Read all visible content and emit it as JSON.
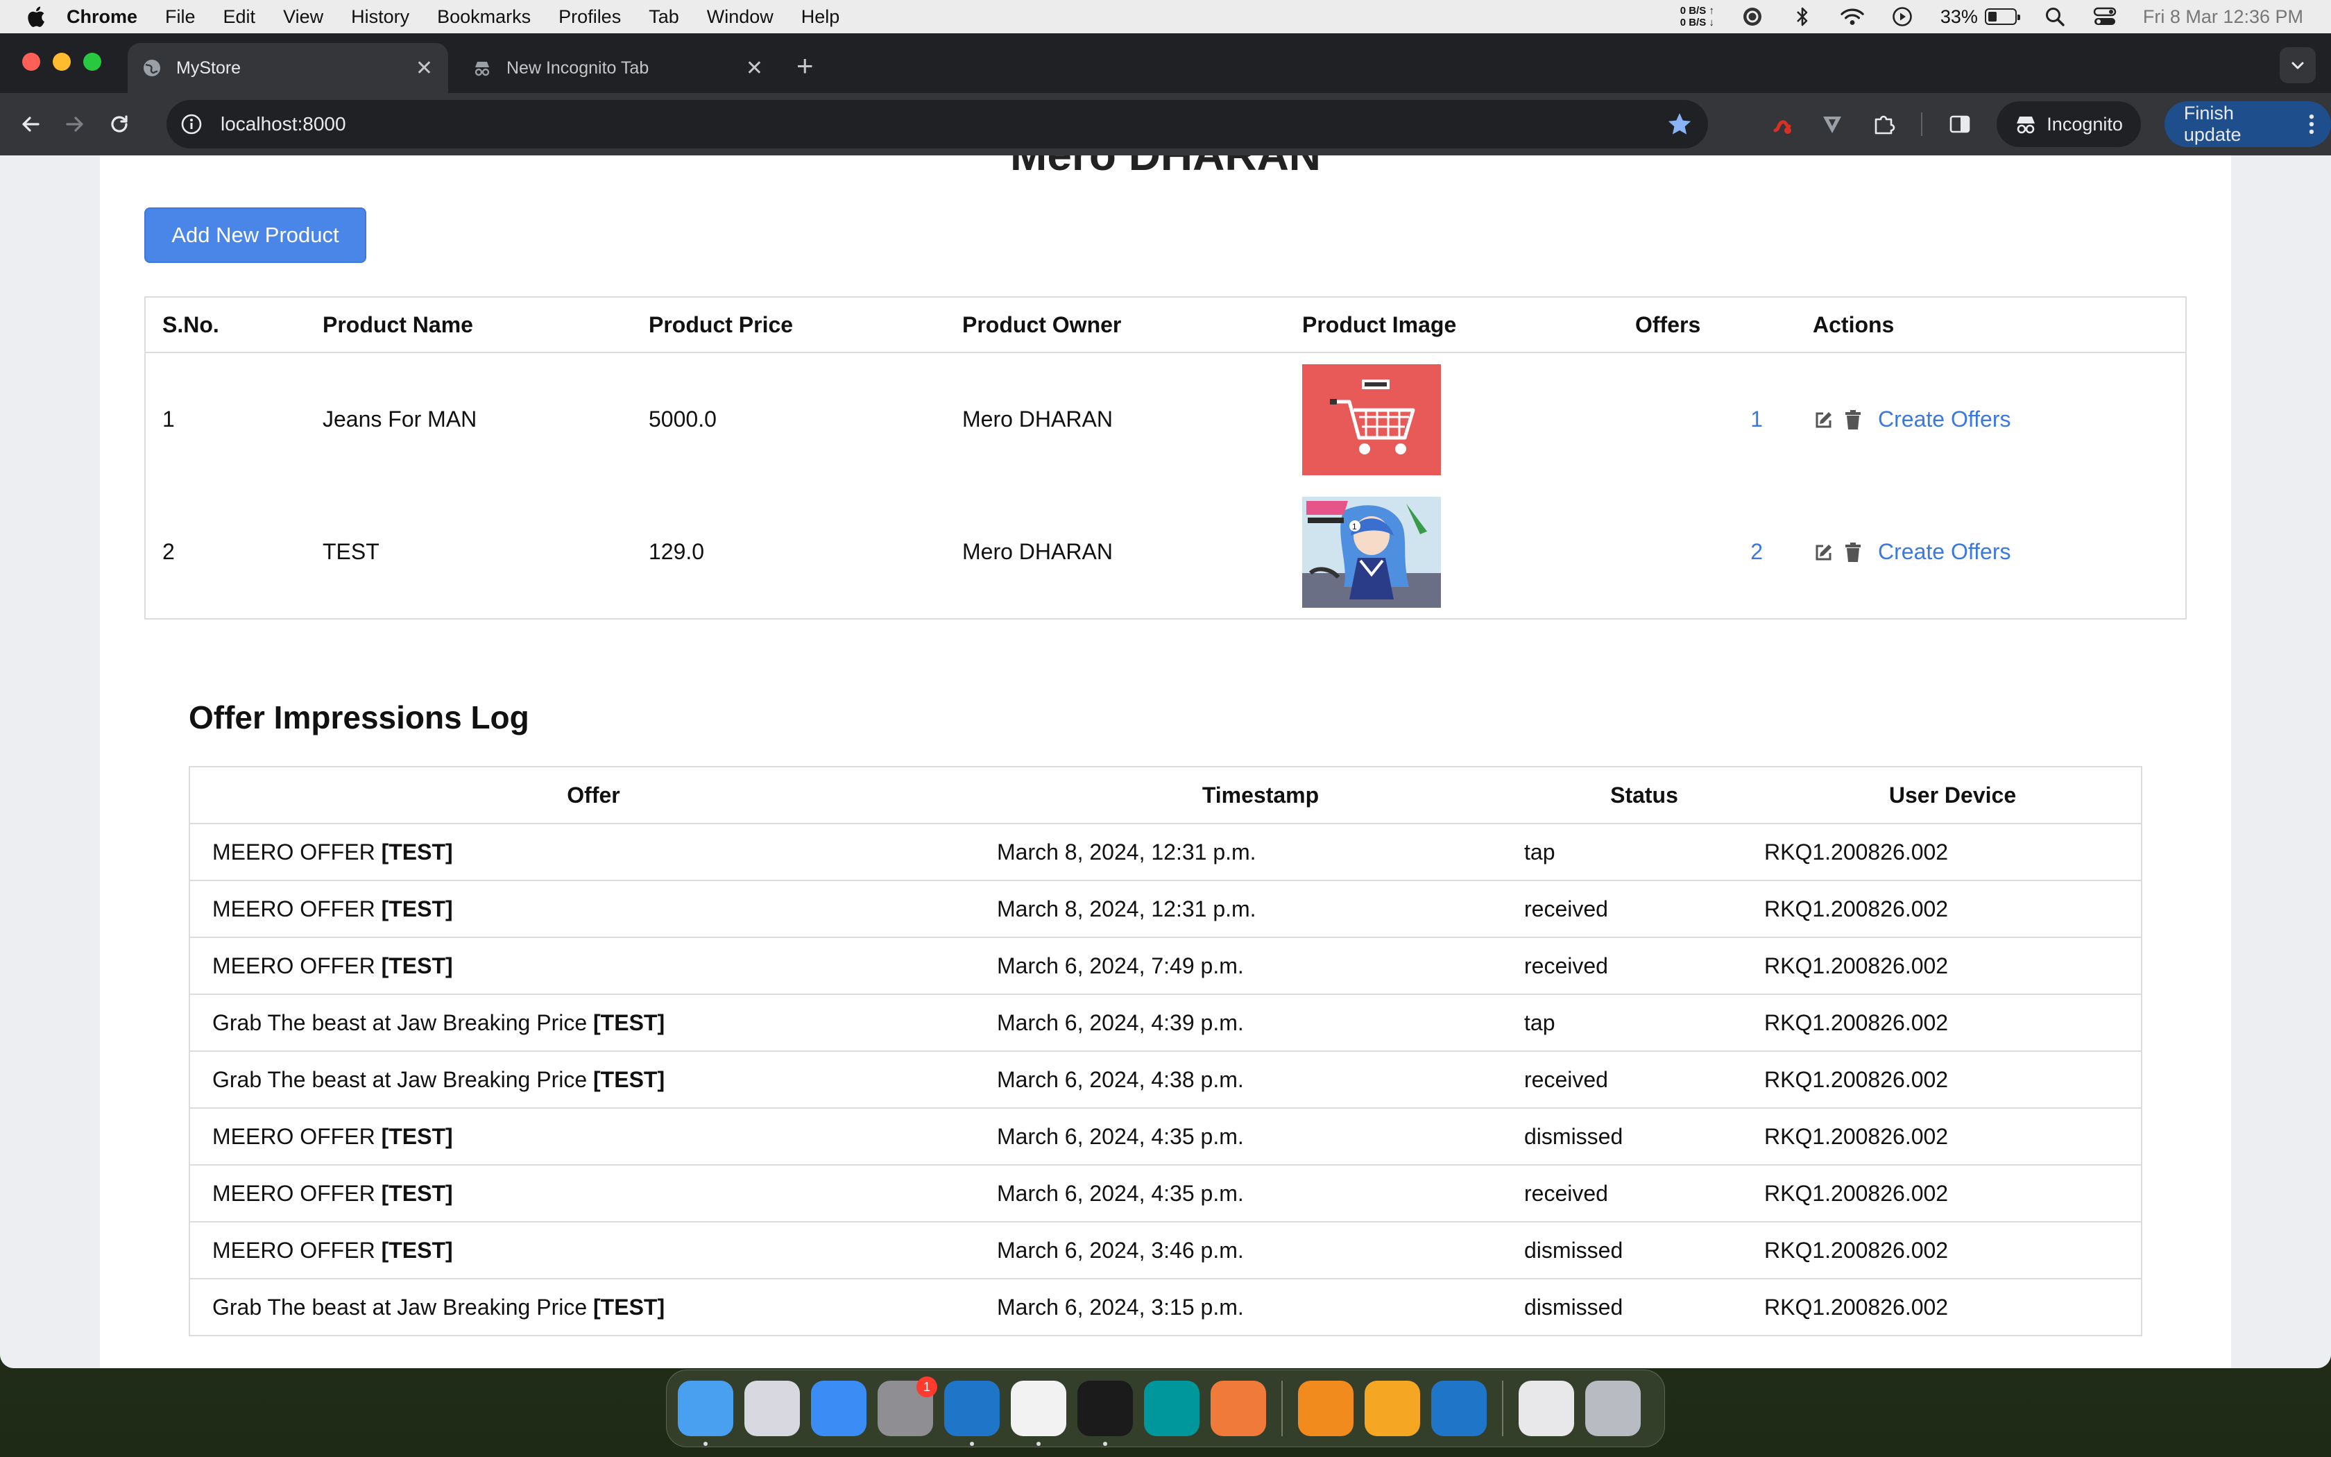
{
  "menubar": {
    "items": [
      "Chrome",
      "File",
      "Edit",
      "View",
      "History",
      "Bookmarks",
      "Profiles",
      "Tab",
      "Window",
      "Help"
    ],
    "net_up": "0 B/S ↑",
    "net_down": "0 B/S ↓",
    "battery_percent": "33%",
    "battery_level": 0.33,
    "clock": "Fri 8 Mar  12:36 PM"
  },
  "browser": {
    "tabs": [
      {
        "title": "MyStore",
        "icon": "globe-icon"
      },
      {
        "title": "New Incognito Tab",
        "icon": "incognito-icon"
      }
    ],
    "url": "localhost:8000",
    "incognito_label": "Incognito",
    "update_label": "Finish update"
  },
  "page": {
    "site_title": "Mero DHARAN",
    "add_button": "Add New Product",
    "products_table": {
      "headers": [
        "S.No.",
        "Product Name",
        "Product Price",
        "Product Owner",
        "Product Image",
        "Offers",
        "Actions"
      ],
      "rows": [
        {
          "sno": "1",
          "name": "Jeans For MAN",
          "price": "5000.0",
          "owner": "Mero DHARAN",
          "image": "shopping-cart-image",
          "offers": "1",
          "action_link": "Create Offers"
        },
        {
          "sno": "2",
          "name": "TEST",
          "price": "129.0",
          "owner": "Mero DHARAN",
          "image": "anime-cover-image",
          "offers": "2",
          "action_link": "Create Offers"
        }
      ]
    },
    "log_title": "Offer Impressions Log",
    "log_table": {
      "headers": [
        "Offer",
        "Timestamp",
        "Status",
        "User Device"
      ],
      "rows": [
        {
          "offer": "MEERO OFFER",
          "tag": "[TEST]",
          "timestamp": "March 8, 2024, 12:31 p.m.",
          "status": "tap",
          "device": "RKQ1.200826.002"
        },
        {
          "offer": "MEERO OFFER",
          "tag": "[TEST]",
          "timestamp": "March 8, 2024, 12:31 p.m.",
          "status": "received",
          "device": "RKQ1.200826.002"
        },
        {
          "offer": "MEERO OFFER",
          "tag": "[TEST]",
          "timestamp": "March 6, 2024, 7:49 p.m.",
          "status": "received",
          "device": "RKQ1.200826.002"
        },
        {
          "offer": "Grab The beast at Jaw Breaking Price",
          "tag": "[TEST]",
          "timestamp": "March 6, 2024, 4:39 p.m.",
          "status": "tap",
          "device": "RKQ1.200826.002"
        },
        {
          "offer": "Grab The beast at Jaw Breaking Price",
          "tag": "[TEST]",
          "timestamp": "March 6, 2024, 4:38 p.m.",
          "status": "received",
          "device": "RKQ1.200826.002"
        },
        {
          "offer": "MEERO OFFER",
          "tag": "[TEST]",
          "timestamp": "March 6, 2024, 4:35 p.m.",
          "status": "dismissed",
          "device": "RKQ1.200826.002"
        },
        {
          "offer": "MEERO OFFER",
          "tag": "[TEST]",
          "timestamp": "March 6, 2024, 4:35 p.m.",
          "status": "received",
          "device": "RKQ1.200826.002"
        },
        {
          "offer": "MEERO OFFER",
          "tag": "[TEST]",
          "timestamp": "March 6, 2024, 3:46 p.m.",
          "status": "dismissed",
          "device": "RKQ1.200826.002"
        },
        {
          "offer": "Grab The beast at Jaw Breaking Price",
          "tag": "[TEST]",
          "timestamp": "March 6, 2024, 3:15 p.m.",
          "status": "dismissed",
          "device": "RKQ1.200826.002"
        }
      ]
    }
  },
  "dock": {
    "apps": [
      {
        "name": "finder-icon",
        "color": "#4aa0f0"
      },
      {
        "name": "launchpad-icon",
        "color": "#d8d8e0"
      },
      {
        "name": "safari-icon",
        "color": "#3b8df5"
      },
      {
        "name": "system-settings-icon",
        "color": "#8e8e93",
        "badge": "1"
      },
      {
        "name": "vscode-icon",
        "color": "#1f76c9"
      },
      {
        "name": "chrome-icon",
        "color": "#f2f2f2"
      },
      {
        "name": "terminal-icon",
        "color": "#1b1b1b"
      },
      {
        "name": "arduino-icon",
        "color": "#00979c"
      },
      {
        "name": "pen-app-icon",
        "color": "#f07a3a"
      },
      {
        "name": "vlc-icon",
        "color": "#f28b1d"
      },
      {
        "name": "pages-icon",
        "color": "#f5a623"
      },
      {
        "name": "vscode-icon-2",
        "color": "#1f76c9"
      },
      {
        "name": "document-icon",
        "color": "#e8e8ea"
      },
      {
        "name": "trash-icon",
        "color": "#b8bcc2"
      }
    ]
  },
  "colors": {
    "accent_blue": "#4a86e8",
    "link_blue": "#3b79e0",
    "chrome_dark": "#202124",
    "update_button": "#1f4e8c"
  }
}
